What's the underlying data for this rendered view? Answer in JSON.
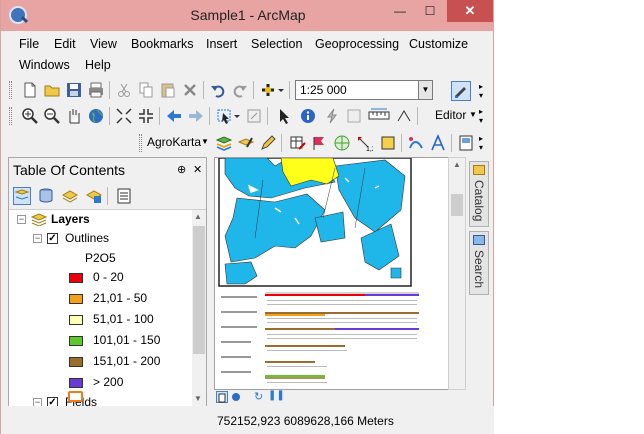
{
  "window": {
    "title": "Sample1 - ArcMap",
    "min_glyph": "—",
    "max_glyph": "☐",
    "close_glyph": "✕"
  },
  "menu": [
    "File",
    "Edit",
    "View",
    "Bookmarks",
    "Insert",
    "Selection",
    "Geoprocessing",
    "Customize",
    "Windows",
    "Help"
  ],
  "toolbar": {
    "scale": "1:25 000",
    "editor_label": "Editor",
    "agrokarta_label": "AgroKarta"
  },
  "toc": {
    "title": "Table Of Contents",
    "pin": "⊕",
    "close": "✕",
    "layers_group": "Layers",
    "outlines_layer": "Outlines",
    "field_name": "P2O5",
    "classes": [
      {
        "label": "0 - 20",
        "color": "#e8000b"
      },
      {
        "label": "21,01 - 50",
        "color": "#f5a01a"
      },
      {
        "label": "51,01 - 100",
        "color": "#ffffb3"
      },
      {
        "label": "101,01 - 150",
        "color": "#5cc92b"
      },
      {
        "label": "151,01 - 200",
        "color": "#9a6c2e"
      },
      {
        "label": "> 200",
        "color": "#6a3ad6"
      }
    ],
    "fields_layer": "Fields",
    "fields_symbol_color": "#f27a1e"
  },
  "map": {
    "field_color": "#1fb7ea",
    "highlight_color": "#ffff1a"
  },
  "dock": {
    "catalog": "Catalog",
    "search": "Search"
  },
  "status": {
    "coords": "752152,923  6089628,166 Meters"
  }
}
